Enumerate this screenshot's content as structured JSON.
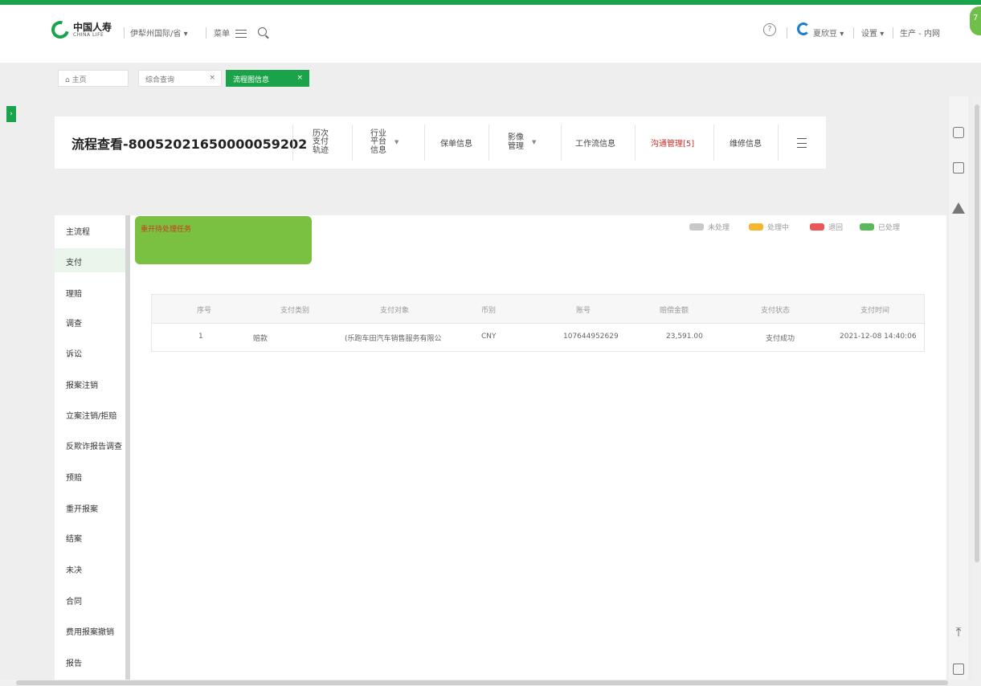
{
  "header": {
    "logo_cn": "中国人寿",
    "logo_en": "CHINA LIFE",
    "org_selector": "伊犁州国际/省",
    "menu_label": "菜单",
    "user_name": "夏欣豆",
    "settings_label": "设置",
    "env_label": "生产 - 内网",
    "help_glyph": "?",
    "avatar_text": "7"
  },
  "tabs": [
    {
      "label": "主页"
    },
    {
      "label": "综合查询"
    },
    {
      "label": "流程图信息"
    }
  ],
  "title_card": {
    "title": "流程查看-80052021650000059202",
    "nav": [
      {
        "label": "历次\n支付\n轨迹"
      },
      {
        "label": "行业\n平台\n信息"
      },
      {
        "label": "保单信息"
      },
      {
        "label": "影像\n管理"
      },
      {
        "label": "工作流信息"
      },
      {
        "label": "沟通管理[5]"
      },
      {
        "label": "维修信息"
      }
    ]
  },
  "side_nav": {
    "items": [
      {
        "label": "主流程"
      },
      {
        "label": "支付"
      },
      {
        "label": "理赔"
      },
      {
        "label": "调查"
      },
      {
        "label": "诉讼"
      },
      {
        "label": "报案注销"
      },
      {
        "label": "立案注销/拒赔"
      },
      {
        "label": "反欺诈报告调查"
      },
      {
        "label": "预赔"
      },
      {
        "label": "重开报案"
      },
      {
        "label": "结案"
      },
      {
        "label": "未决"
      },
      {
        "label": "合同"
      },
      {
        "label": "费用报案撤销"
      },
      {
        "label": "报告"
      }
    ]
  },
  "content": {
    "badge_label": "重开待处理任务",
    "legend": [
      {
        "label": "未处理",
        "color": "#c8c8c8"
      },
      {
        "label": "处理中",
        "color": "#f5b731"
      },
      {
        "label": "退回",
        "color": "#e9575a"
      },
      {
        "label": "已处理",
        "color": "#5cb85c"
      }
    ],
    "table": {
      "columns": [
        "序号",
        "支付类别",
        "支付对象",
        "币别",
        "账号",
        "赔偿金额",
        "支付状态",
        "支付时间"
      ],
      "rows": [
        [
          "1",
          "赔款",
          "(乐跑车田汽车销售服务有限公",
          "CNY",
          "107644952629",
          "23,591.00",
          "支付成功",
          "2021-12-08 14:40:06"
        ]
      ]
    }
  },
  "colors": {
    "accent": "#1aa34a",
    "badge": "#7ac142",
    "alert_text": "#c9302c"
  }
}
